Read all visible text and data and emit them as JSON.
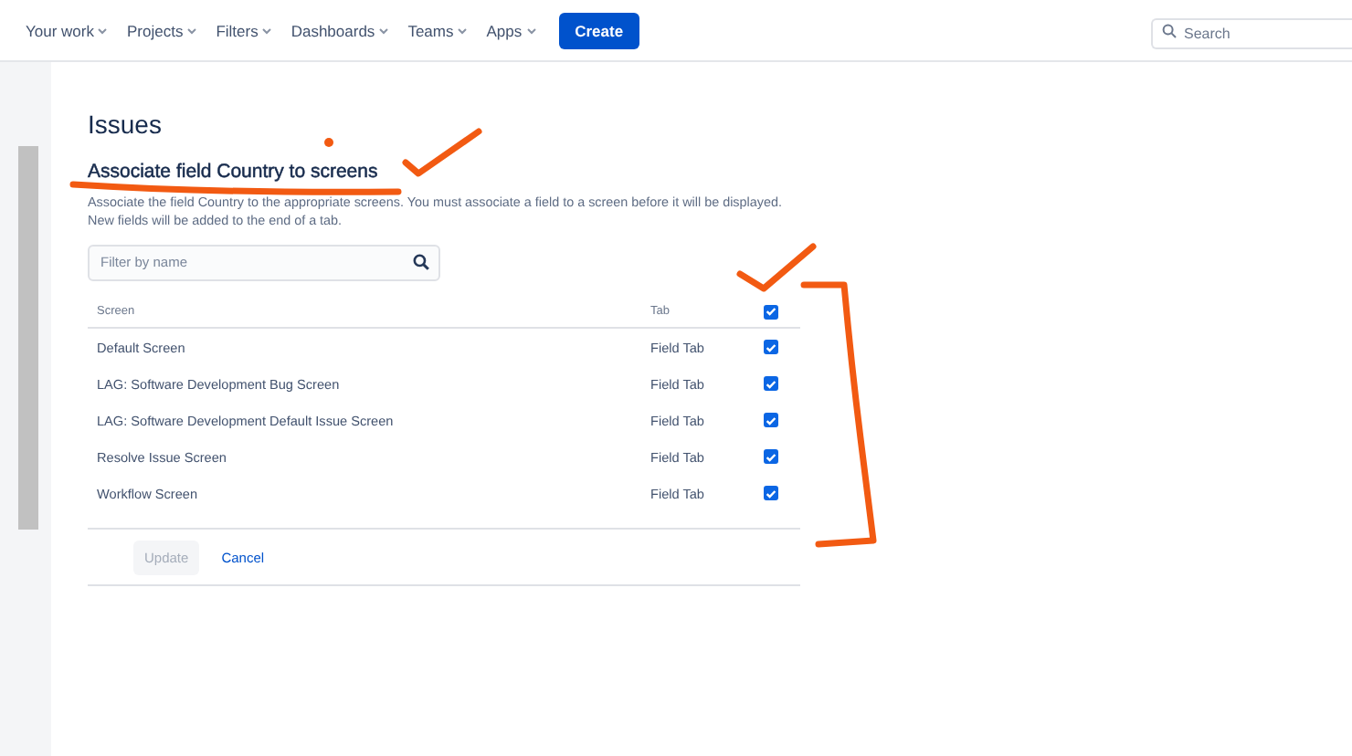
{
  "nav": {
    "items": [
      {
        "label": "Your work"
      },
      {
        "label": "Projects"
      },
      {
        "label": "Filters"
      },
      {
        "label": "Dashboards"
      },
      {
        "label": "Teams"
      },
      {
        "label": "Apps"
      }
    ],
    "create": "Create",
    "search": {
      "placeholder": "Search"
    }
  },
  "page": {
    "title": "Issues",
    "heading": "Associate field Country to screens",
    "description": "Associate the field Country to the appropriate screens. You must associate a field to a screen before it will be displayed. New fields will be added to the end of a tab.",
    "filter": {
      "placeholder": "Filter by name"
    }
  },
  "table": {
    "columns": [
      "Screen",
      "Tab"
    ],
    "all_checked": true,
    "rows": [
      {
        "screen": "Default Screen",
        "tab": "Field Tab",
        "checked": true
      },
      {
        "screen": "LAG: Software Development Bug Screen",
        "tab": "Field Tab",
        "checked": true
      },
      {
        "screen": "LAG: Software Development Default Issue Screen",
        "tab": "Field Tab",
        "checked": true
      },
      {
        "screen": "Resolve Issue Screen",
        "tab": "Field Tab",
        "checked": true
      },
      {
        "screen": "Workflow Screen",
        "tab": "Field Tab",
        "checked": true
      }
    ]
  },
  "buttons": {
    "update": "Update",
    "cancel": "Cancel"
  }
}
